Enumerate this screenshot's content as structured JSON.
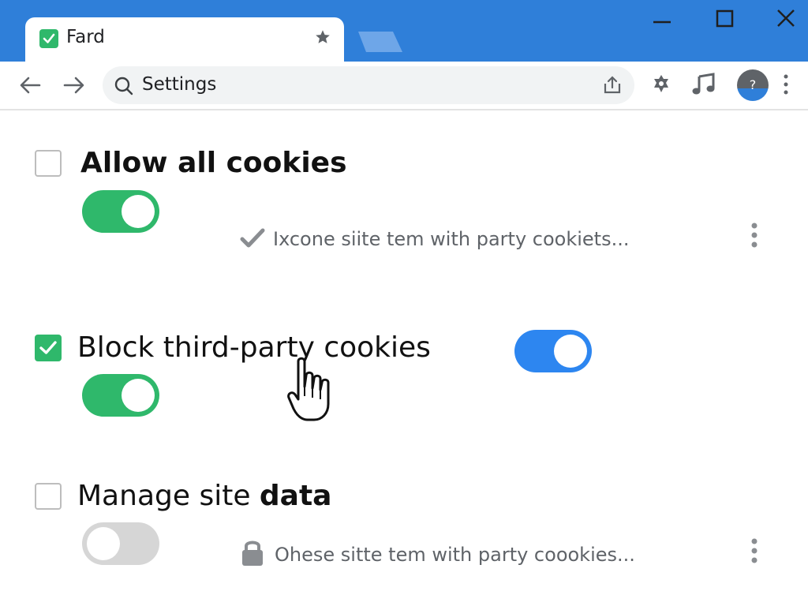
{
  "browser": {
    "tab": {
      "title": "Fard",
      "favicon": "check-square-icon"
    },
    "window_controls": [
      "minimize-icon",
      "maximize-icon",
      "close-icon"
    ],
    "omnibox": {
      "text": "Settings"
    },
    "avatar_label": "?"
  },
  "settings": {
    "rows": [
      {
        "title": "Allow all cookies",
        "checked": false,
        "toggle_on": true,
        "description": "Ixcone siite tem with party cookiets..."
      },
      {
        "title": "Block third-party cookies",
        "checked": true,
        "toggle_on": true,
        "secondary_toggle_on": true
      },
      {
        "title_regular": "Manage site ",
        "title_bold": "data",
        "checked": false,
        "toggle_on": false,
        "description": "Ohese sitte tem with party coookies..."
      }
    ]
  },
  "colors": {
    "tabbar": "#2f7fd9",
    "toggle_green": "#2fb86b",
    "toggle_blue": "#2d86f0",
    "toggle_off": "#d6d6d6"
  }
}
